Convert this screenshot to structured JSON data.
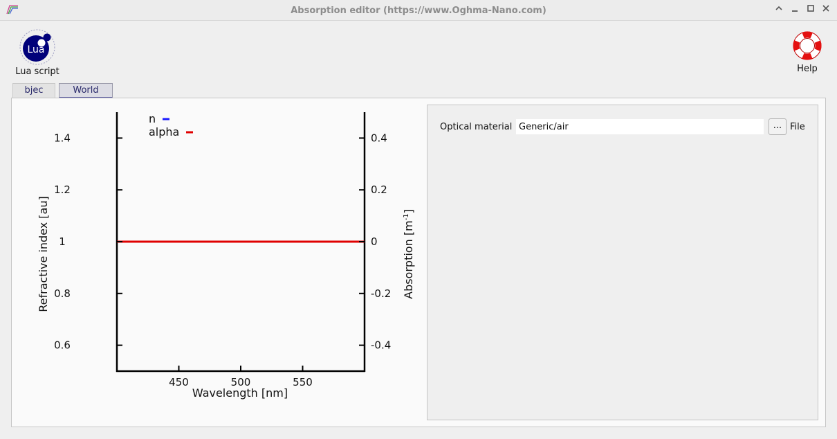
{
  "window": {
    "title": "Absorption editor (https://www.Oghma-Nano.com)",
    "controls": {
      "rollup": "^",
      "minimize": "_",
      "maximize": "☐",
      "close": "✕"
    }
  },
  "toolbar": {
    "lua": {
      "icon_text": "Lua",
      "label": "Lua script",
      "icon": "lua-logo-icon"
    },
    "help": {
      "label": "Help",
      "icon": "lifebuoy-icon"
    }
  },
  "tabs": [
    {
      "label": "bjec",
      "active": false
    },
    {
      "label": "World",
      "active": true
    }
  ],
  "material": {
    "label": "Optical material",
    "value": "Generic/air",
    "browse_label": "...",
    "file_label": "File"
  },
  "colors": {
    "n_series": "#1a1aff",
    "alpha_series": "#e00000"
  },
  "chart_data": {
    "type": "line",
    "xlabel": "Wavelength [nm]",
    "ylabel_left": "Refractive index [au]",
    "ylabel_right_base": "Absorption [m",
    "ylabel_right_sup": "-1",
    "ylabel_right_end": "]",
    "xlim": [
      400,
      600
    ],
    "ylim_left": [
      0.5,
      1.5
    ],
    "ylim_right": [
      -0.5,
      0.5
    ],
    "xticks": [
      450,
      500,
      550
    ],
    "yticks_left": [
      0.6,
      0.8,
      1.0,
      1.2,
      1.4
    ],
    "yticks_left_labels": [
      "0.6",
      "0.8",
      "1",
      "1.2",
      "1.4"
    ],
    "yticks_right": [
      -0.4,
      -0.2,
      0,
      0.2,
      0.4
    ],
    "yticks_right_labels": [
      "-0.4",
      "-0.2",
      "0",
      "0.2",
      "0.4"
    ],
    "legend_position": "top-left",
    "grid": false,
    "series": [
      {
        "name": "n",
        "axis": "left",
        "x": [
          400,
          600
        ],
        "y": [
          1.0,
          1.0
        ]
      },
      {
        "name": "alpha",
        "axis": "right",
        "x": [
          400,
          600
        ],
        "y": [
          0,
          0
        ]
      }
    ]
  }
}
